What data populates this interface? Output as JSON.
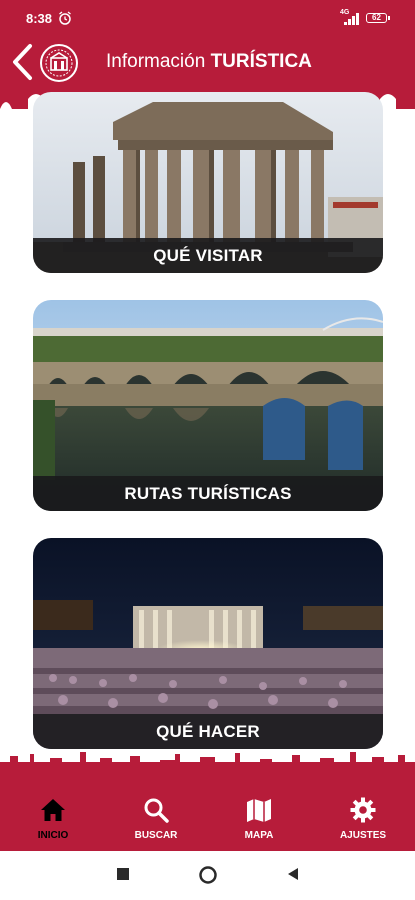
{
  "status_bar": {
    "time": "8:38",
    "network": "4G",
    "battery": "62",
    "icons": [
      "alarm-icon",
      "signal-icon",
      "battery-icon"
    ]
  },
  "header": {
    "title_regular": "Información",
    "title_bold": "TURÍSTICA",
    "icons": [
      "back-arrow-icon",
      "city-logo-icon"
    ]
  },
  "cards": [
    {
      "label": "QUÉ VISITAR",
      "image": "roman-temple-photo"
    },
    {
      "label": "RUTAS TURÍSTICAS",
      "image": "roman-bridge-photo"
    },
    {
      "label": "QUÉ HACER",
      "image": "roman-theatre-night-photo"
    }
  ],
  "bottom_nav": {
    "items": [
      {
        "label": "INICIO",
        "icon": "home-icon",
        "active": true
      },
      {
        "label": "BUSCAR",
        "icon": "search-icon",
        "active": false
      },
      {
        "label": "MAPA",
        "icon": "map-icon",
        "active": false
      },
      {
        "label": "AJUSTES",
        "icon": "gear-icon",
        "active": false
      }
    ]
  },
  "colors": {
    "brand": "#b71c3a",
    "label_bg": "#19191c",
    "active_nav_label": "#000000"
  }
}
